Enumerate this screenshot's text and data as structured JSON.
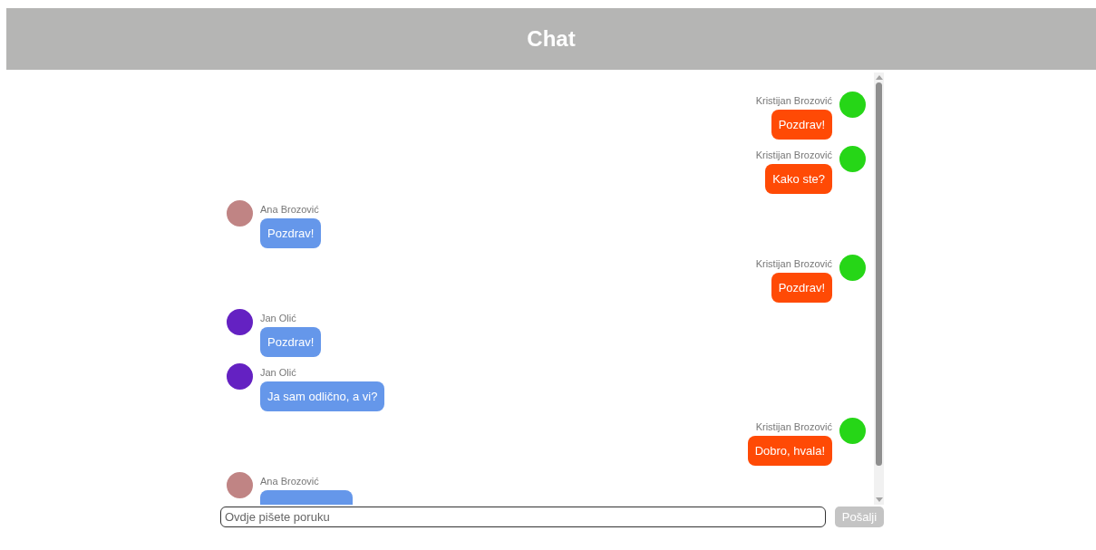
{
  "header": {
    "title": "Chat"
  },
  "messages": [
    {
      "kind": "own",
      "author": "Kristijan Brozović",
      "color": "#26d617",
      "text": "Pozdrav!"
    },
    {
      "kind": "own",
      "author": "Kristijan Brozović",
      "color": "#26d617",
      "text": "Kako ste?"
    },
    {
      "kind": "other",
      "author": "Ana Brozović",
      "color": "#c08484",
      "text": "Pozdrav!"
    },
    {
      "kind": "own",
      "author": "Kristijan Brozović",
      "color": "#26d617",
      "text": "Pozdrav!"
    },
    {
      "kind": "other",
      "author": "Jan Olić",
      "color": "#6421c2",
      "text": "Pozdrav!"
    },
    {
      "kind": "other",
      "author": "Jan Olić",
      "color": "#6421c2",
      "text": "Ja sam odlično, a vi?"
    },
    {
      "kind": "own",
      "author": "Kristijan Brozović",
      "color": "#26d617",
      "text": "Dobro, hvala!"
    },
    {
      "kind": "other",
      "author": "Ana Brozović",
      "color": "#c08484"
    }
  ],
  "composer": {
    "placeholder": "Ovdje pišete poruku",
    "send_label": "Pošalji",
    "send_disabled": true
  }
}
